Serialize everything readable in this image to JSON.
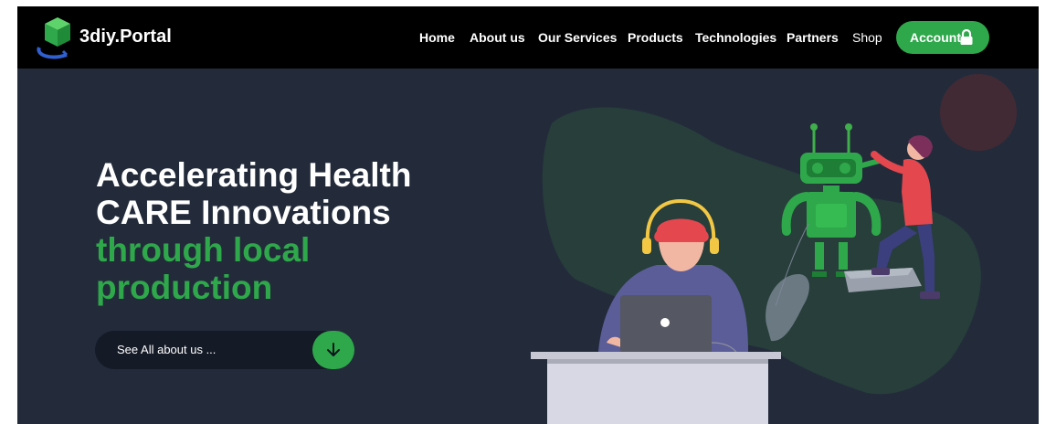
{
  "brand": {
    "name": "3diy.Portal"
  },
  "nav": {
    "items": [
      {
        "label": "Home"
      },
      {
        "label": "About us"
      },
      {
        "label": "Our Services"
      },
      {
        "label": "Products"
      },
      {
        "label": "Technologies"
      },
      {
        "label": "Partners"
      },
      {
        "label": "Shop"
      }
    ],
    "account": {
      "label": "Account",
      "icon": "lock-icon"
    }
  },
  "hero": {
    "headline_line1": "Accelerating Health",
    "headline_line2": "CARE Innovations",
    "headline_line3": "through local",
    "headline_line4": "production",
    "cta_label": "See All about us ...",
    "cta_icon": "arrow-down-icon"
  },
  "colors": {
    "navbar_bg": "#000000",
    "hero_bg": "#232b3b",
    "accent_green": "#2ea84a",
    "cta_bg": "#141a26"
  }
}
